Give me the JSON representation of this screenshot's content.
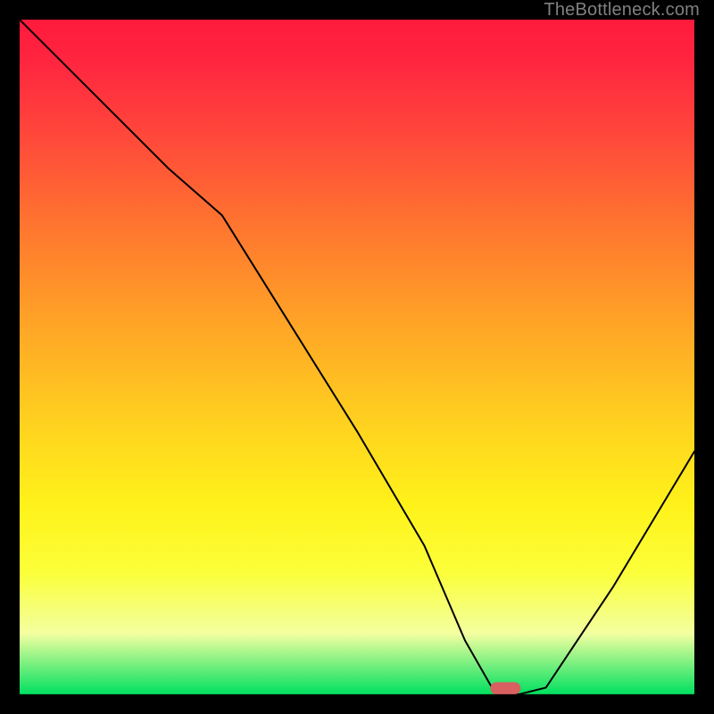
{
  "watermark": "TheBottleneck.com",
  "chart_data": {
    "type": "line",
    "title": "",
    "xlabel": "",
    "ylabel": "",
    "xlim": [
      0,
      100
    ],
    "ylim": [
      0,
      100
    ],
    "series": [
      {
        "name": "bottleneck-curve",
        "x": [
          0,
          10,
          22,
          30,
          40,
          50,
          60,
          66,
          70,
          74,
          78,
          88,
          100
        ],
        "values": [
          100,
          90,
          78,
          71,
          55,
          39,
          22,
          8,
          1,
          0,
          1,
          16,
          36
        ]
      }
    ],
    "marker": {
      "label": "optimal-point",
      "x": 72,
      "y": 0,
      "color": "#d86060",
      "width": 4.5,
      "height": 1.8
    },
    "gradient_stops": [
      {
        "pos": 0,
        "color": "#ff1a3c"
      },
      {
        "pos": 6,
        "color": "#ff2540"
      },
      {
        "pos": 18,
        "color": "#ff4a3a"
      },
      {
        "pos": 32,
        "color": "#ff7a2e"
      },
      {
        "pos": 46,
        "color": "#ffa726"
      },
      {
        "pos": 60,
        "color": "#ffd21f"
      },
      {
        "pos": 72,
        "color": "#fff21a"
      },
      {
        "pos": 82,
        "color": "#fbff3a"
      },
      {
        "pos": 91,
        "color": "#f3ffa0"
      },
      {
        "pos": 100,
        "color": "#00e060"
      }
    ]
  }
}
